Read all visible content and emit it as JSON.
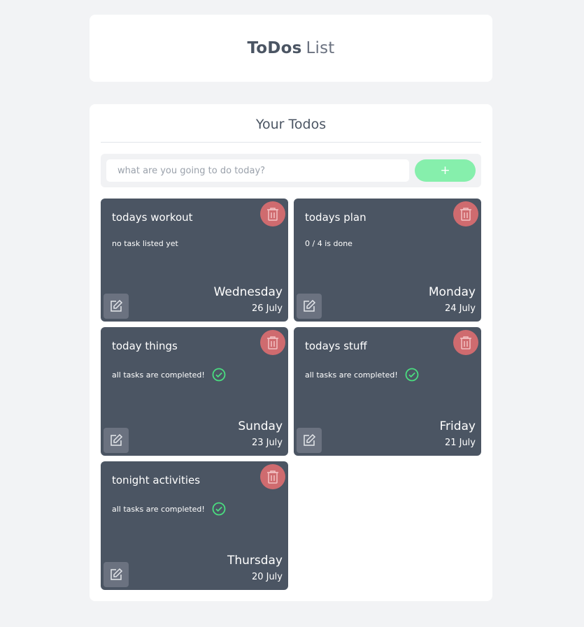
{
  "app": {
    "title_bold": "ToDos",
    "title_light": "List"
  },
  "todos_section": {
    "heading": "Your Todos",
    "input_placeholder": "what are you going to do today?",
    "input_value": "",
    "add_button_label": "+"
  },
  "todos": [
    {
      "title": "todays workout",
      "status": "no task listed yet",
      "completed": false,
      "day": "Wednesday",
      "date": "26 July"
    },
    {
      "title": "todays plan",
      "status": "0 / 4 is done",
      "completed": false,
      "day": "Monday",
      "date": "24 July"
    },
    {
      "title": "today things",
      "status": "all tasks are completed!",
      "completed": true,
      "day": "Sunday",
      "date": "23 July"
    },
    {
      "title": "todays stuff",
      "status": "all tasks are completed!",
      "completed": true,
      "day": "Friday",
      "date": "21 July"
    },
    {
      "title": "tonight activities",
      "status": "all tasks are completed!",
      "completed": true,
      "day": "Thursday",
      "date": "20 July"
    }
  ],
  "icons": {
    "delete": "trash-icon",
    "edit": "edit-icon",
    "completed": "check-circle-icon"
  },
  "colors": {
    "background": "#f2f3f5",
    "card": "#4b5563",
    "delete": "#cf6b6f",
    "add_button": "#86efac",
    "check": "#4ade80"
  }
}
